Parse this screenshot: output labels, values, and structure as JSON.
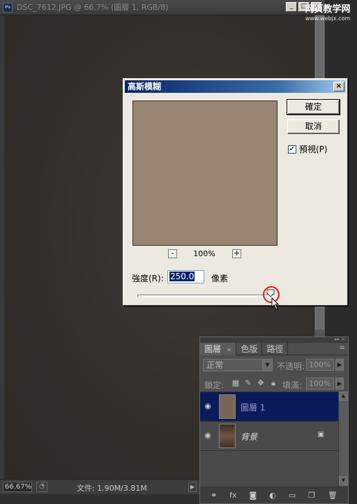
{
  "document": {
    "title": "DSC_7612.JPG @ 66.7% (圖層 1, RGB/8)",
    "zoom": "66.67%",
    "file_info": "文件: 1.90M/3.81M"
  },
  "watermark": {
    "title": "网页教学网",
    "url": "www.webjx.com"
  },
  "dialog": {
    "title": "高斯模糊",
    "ok_label": "確定",
    "cancel_label": "取消",
    "preview_label": "預視(P)",
    "preview_checked": true,
    "zoom_minus": "-",
    "zoom_plus": "+",
    "zoom_level": "100%",
    "radius_label": "強度(R):",
    "radius_value": "250.0",
    "radius_unit": "像素",
    "slider_fraction": 0.97
  },
  "layers_panel": {
    "tabs": [
      {
        "label": "圖層"
      },
      {
        "label": "色版"
      },
      {
        "label": "路徑"
      }
    ],
    "close_glyph": "×",
    "blend_mode": "正常",
    "opacity_label": "不透明:",
    "opacity_value": "100%",
    "lock_label": "鎖定:",
    "fill_label": "填滿:",
    "fill_value": "100%",
    "layers": [
      {
        "name": "圖層 1",
        "selected": true
      },
      {
        "name": "背景",
        "selected": false,
        "locked": true
      }
    ]
  },
  "colors": {
    "preview_fill": "#9a8473",
    "selection": "#0a1a5a",
    "highlight": "#e01c1c"
  }
}
